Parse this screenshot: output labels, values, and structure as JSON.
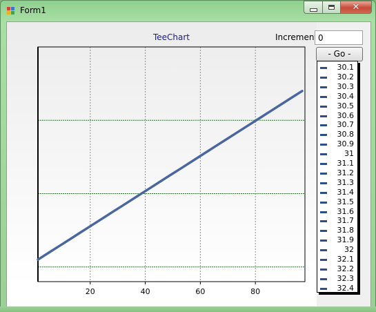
{
  "window": {
    "title": "Form1",
    "close_glyph": "✕",
    "icons": [
      "app-icon",
      "minimize-icon",
      "maximize-icon",
      "close-icon"
    ]
  },
  "controls": {
    "increment_label": "Increment",
    "increment_value": "0",
    "go_label": "- Go -"
  },
  "chart_data": {
    "type": "line",
    "title": "TeeChart",
    "x": [
      1,
      97
    ],
    "series": [
      {
        "values": [
          30.1,
          32.4
        ]
      }
    ],
    "xlim": [
      1,
      98
    ],
    "ylim": [
      29.8,
      33.0
    ],
    "xticks": [
      "20",
      "40",
      "60",
      "80"
    ],
    "yticks": [
      30,
      31,
      32,
      33
    ],
    "grid": true,
    "colors": {
      "line": "#4a66a0",
      "hgrid": "#2a7a2a",
      "vgrid": "#8c8c8c"
    },
    "legend": {
      "placement": "right",
      "items": [
        "30.1",
        "30.2",
        "30.3",
        "30.4",
        "30.5",
        "30.6",
        "30.7",
        "30.8",
        "30.9",
        "31",
        "31.1",
        "31.2",
        "31.3",
        "31.4",
        "31.5",
        "31.6",
        "31.7",
        "31.8",
        "31.9",
        "32",
        "32.1",
        "32.2",
        "32.3",
        "32.4"
      ]
    }
  }
}
